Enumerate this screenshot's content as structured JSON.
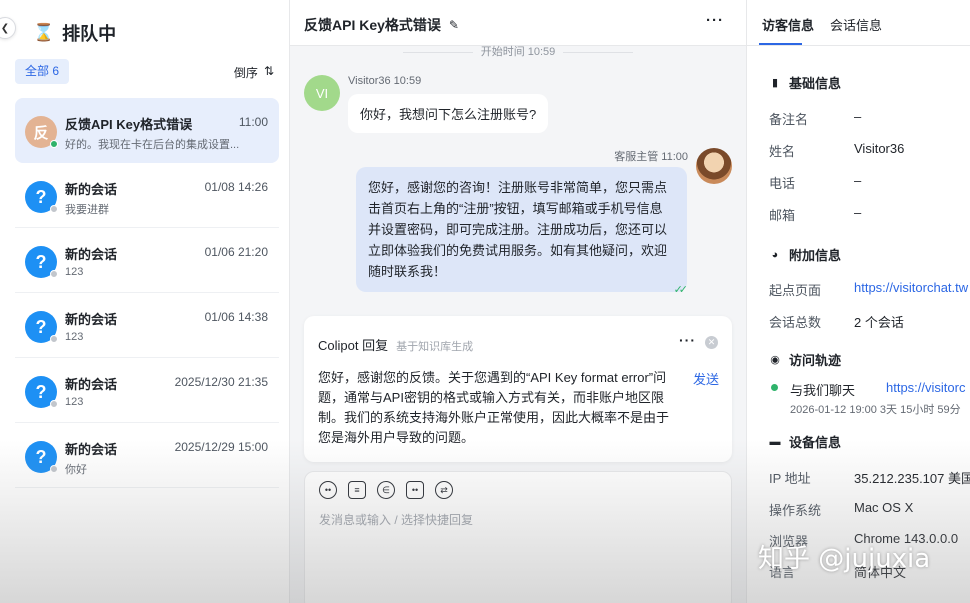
{
  "sidebar": {
    "title": "排队中",
    "filter_label": "全部 6",
    "sort_label": "倒序",
    "conversations": [
      {
        "name": "反馈API Key格式错误",
        "time": "11:00",
        "preview": "好的。我现在卡在后台的集成设置...",
        "avatar": "反",
        "status": "online"
      },
      {
        "name": "新的会话",
        "time": "01/08 14:26",
        "preview": "我要进群",
        "avatar": "?",
        "status": "offline"
      },
      {
        "name": "新的会话",
        "time": "01/06 21:20",
        "preview": "123",
        "avatar": "?",
        "status": "offline"
      },
      {
        "name": "新的会话",
        "time": "01/06 14:38",
        "preview": "123",
        "avatar": "?",
        "status": "offline"
      },
      {
        "name": "新的会话",
        "time": "2025/12/30 21:35",
        "preview": "123",
        "avatar": "?",
        "status": "offline"
      },
      {
        "name": "新的会话",
        "time": "2025/12/29 15:00",
        "preview": "你好",
        "avatar": "?",
        "status": "offline"
      }
    ]
  },
  "chat": {
    "title": "反馈API Key格式错误",
    "start_time": "开始时间 10:59",
    "visitor_avatar": "VI",
    "visitor_meta": "Visitor36 10:59",
    "visitor_message": "你好，我想问下怎么注册账号?",
    "agent_meta": "客服主管 11:00",
    "agent_message": "您好，感谢您的咨询！注册账号非常简单，您只需点击首页右上角的“注册”按钮，填写邮箱或手机号信息并设置密码，即可完成注册。注册成功后，您还可以立即体验我们的免费试用服务。如有其他疑问，欢迎随时联系我！",
    "colipot": {
      "title": "Colipot 回复",
      "subtitle": "基于知识库生成",
      "body": "您好，感谢您的反馈。关于您遇到的“API Key format error”问题，通常与API密钥的格式或输入方式有关，而非账户地区限制。我们的系统支持海外账户正常使用，因此大概率不是由于您是海外用户导致的问题。",
      "send_label": "发送"
    },
    "composer_placeholder": "发消息或输入 / 选择快捷回复"
  },
  "visitor_panel": {
    "tabs": [
      "访客信息",
      "会话信息"
    ],
    "basic_title": "基础信息",
    "basic": [
      {
        "label": "备注名",
        "value": "–"
      },
      {
        "label": "姓名",
        "value": "Visitor36"
      },
      {
        "label": "电话",
        "value": "–"
      },
      {
        "label": "邮箱",
        "value": "–"
      }
    ],
    "extra_title": "附加信息",
    "extra": [
      {
        "label": "起点页面",
        "value": "https://visitorchat.tw"
      },
      {
        "label": "会话总数",
        "value": "2 个会话"
      }
    ],
    "track_title": "访问轨迹",
    "track": {
      "label": "与我们聊天",
      "url": "https://visitorc",
      "time": "2026-01-12 19:00  3天 15小时 59分"
    },
    "device_title": "设备信息",
    "device": [
      {
        "label": "IP 地址",
        "value": "35.212.235.107 美国"
      },
      {
        "label": "操作系统",
        "value": "Mac OS X"
      },
      {
        "label": "浏览器",
        "value": "Chrome 143.0.0.0"
      },
      {
        "label": "语言",
        "value": "简体中文"
      }
    ]
  },
  "watermark": "知乎 @jujuxia",
  "colors": {
    "accent": "#2c67e4",
    "online": "#2fb36b",
    "agent_bubble": "#dde6f8"
  }
}
